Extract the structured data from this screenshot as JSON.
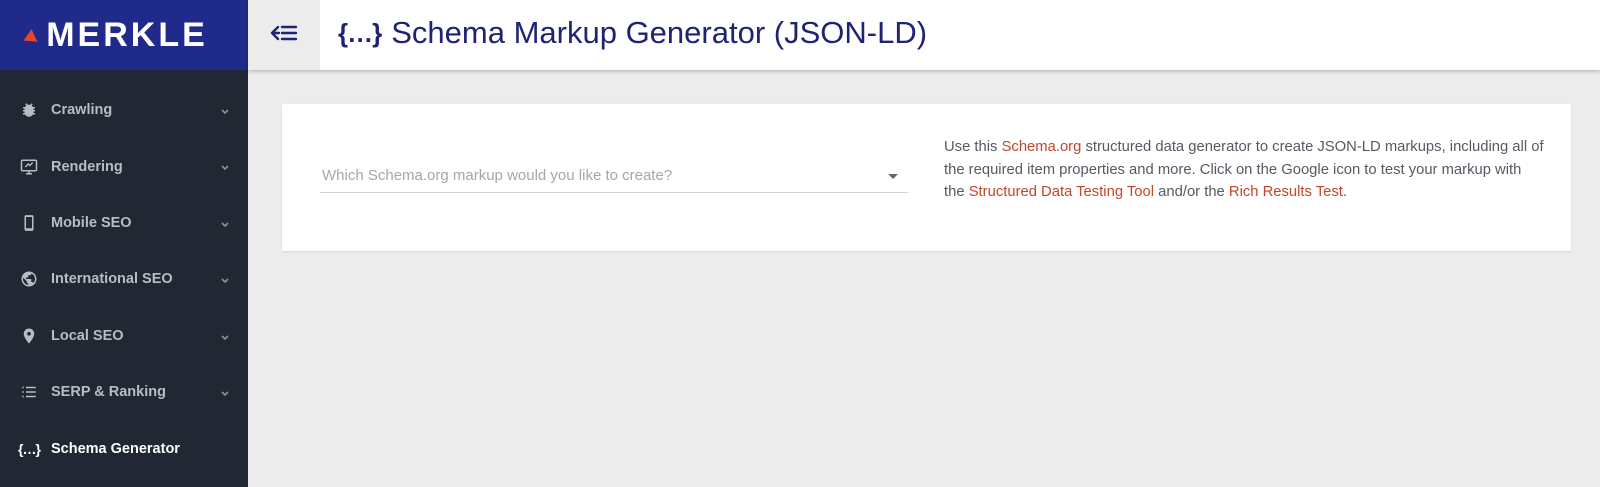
{
  "brand": {
    "name": "MERKLE"
  },
  "colors": {
    "brand_bg": "#1f2a8a",
    "sidebar_bg": "#212733",
    "link": "#c2462a",
    "title": "#1e2473",
    "accent_mark": "#e8462c"
  },
  "sidebar": {
    "items": [
      {
        "label": "Crawling",
        "icon": "bug-icon"
      },
      {
        "label": "Rendering",
        "icon": "monitor-icon"
      },
      {
        "label": "Mobile SEO",
        "icon": "mobile-icon"
      },
      {
        "label": "International SEO",
        "icon": "globe-icon"
      },
      {
        "label": "Local SEO",
        "icon": "map-pin-icon"
      },
      {
        "label": "SERP & Ranking",
        "icon": "list-icon"
      },
      {
        "label": "Schema Generator",
        "icon": "braces-icon",
        "active": true
      }
    ]
  },
  "header": {
    "title": "Schema Markup Generator (JSON-LD)",
    "icon": "braces-icon",
    "collapse_icon": "collapse-menu-icon"
  },
  "main": {
    "select": {
      "placeholder": "Which Schema.org markup would you like to create?"
    },
    "description": {
      "part1": "Use this ",
      "link1": "Schema.org",
      "part2": " structured data generator to create JSON-LD markups, including all of the required item properties and more. Click on the Google icon to test your markup with the ",
      "link2": "Structured Data Testing Tool",
      "part3": " and/or the ",
      "link3": "Rich Results Test",
      "part4": "."
    }
  }
}
